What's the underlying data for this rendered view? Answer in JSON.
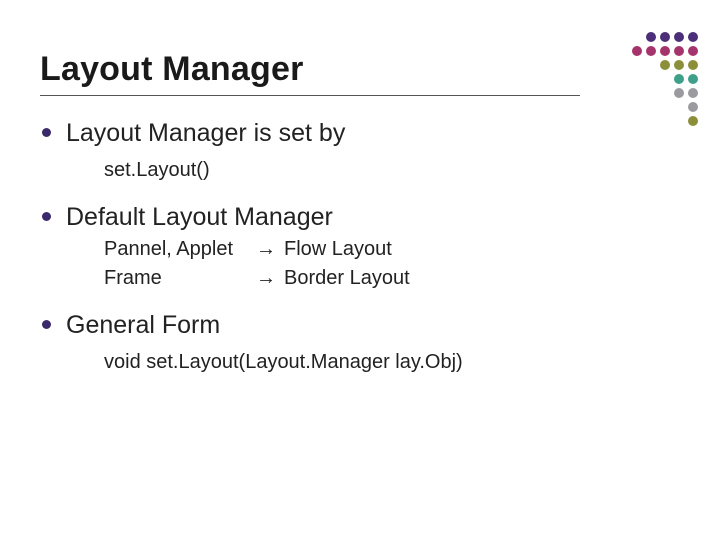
{
  "title": "Layout Manager",
  "bullets": [
    {
      "text": "Layout Manager is set by",
      "sub": "set.Layout()"
    },
    {
      "text": "Default Layout Manager",
      "pairs": [
        {
          "left": "Pannel, Applet",
          "arrow": "→",
          "right": "Flow Layout"
        },
        {
          "left": "Frame",
          "arrow": "→",
          "right": "Border Layout"
        }
      ]
    },
    {
      "text": "General Form",
      "sub": "void set.Layout(Layout.Manager lay.Obj)"
    }
  ]
}
